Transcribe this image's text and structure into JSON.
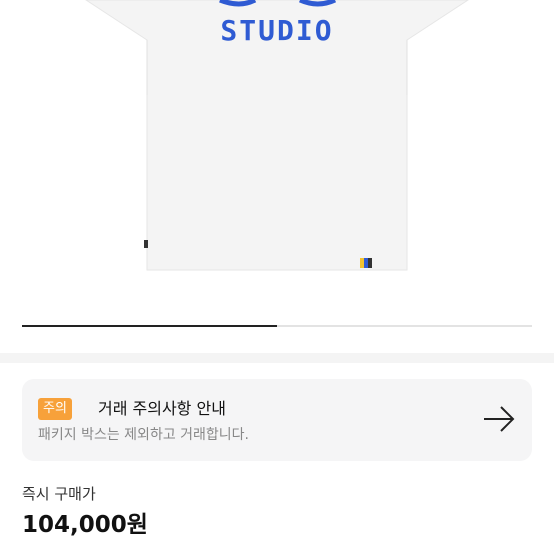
{
  "product": {
    "image_print_text": "STUDIO",
    "carousel_progress": 0.5
  },
  "notice": {
    "badge": "주의",
    "title": "거래 주의사항 안내",
    "subtitle": "패키지 박스는 제외하고 거래합니다."
  },
  "price": {
    "label": "즉시 구매가",
    "value": "104,000원"
  },
  "colors": {
    "accent_badge": "#f7a13a",
    "print_blue": "#2f5bd3"
  }
}
